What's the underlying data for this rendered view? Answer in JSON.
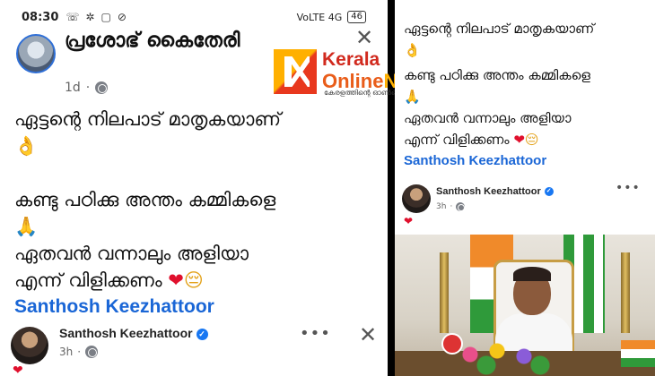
{
  "status_bar": {
    "time": "08:30",
    "icons": [
      "☏",
      "✲",
      "▢",
      "⊘"
    ],
    "network": "VoLTE 4G",
    "battery": "46"
  },
  "post": {
    "author": "പ്രശോഭ് കൈതേരി",
    "time": "1d",
    "line1": "ഏട്ടന്റെ നിലപാട് മാതൃകയാണ്",
    "line2": "കണ്ടു പഠിക്കു അന്തം കമ്മികളെ",
    "line3": "ഏതവൻ വന്നാലും അളിയാ",
    "line4": "എന്ന് വിളിക്കണം",
    "signature": "Santhosh Keezhattoor",
    "emoji_ok": "👌",
    "emoji_pray": "🙏",
    "emoji_heart": "❤",
    "emoji_face": "😔"
  },
  "comment": {
    "name": "Santhosh Keezhattoor",
    "time": "3h",
    "heart": "❤"
  },
  "logo": {
    "kerala": "Kerala",
    "online": "Online",
    "news": "News",
    "tagline": "കേരളത്തിന്റെ ഓൺലൈൻ വാർത്ത"
  },
  "icons": {
    "close": "✕",
    "more": "•••",
    "verified": "✓"
  }
}
